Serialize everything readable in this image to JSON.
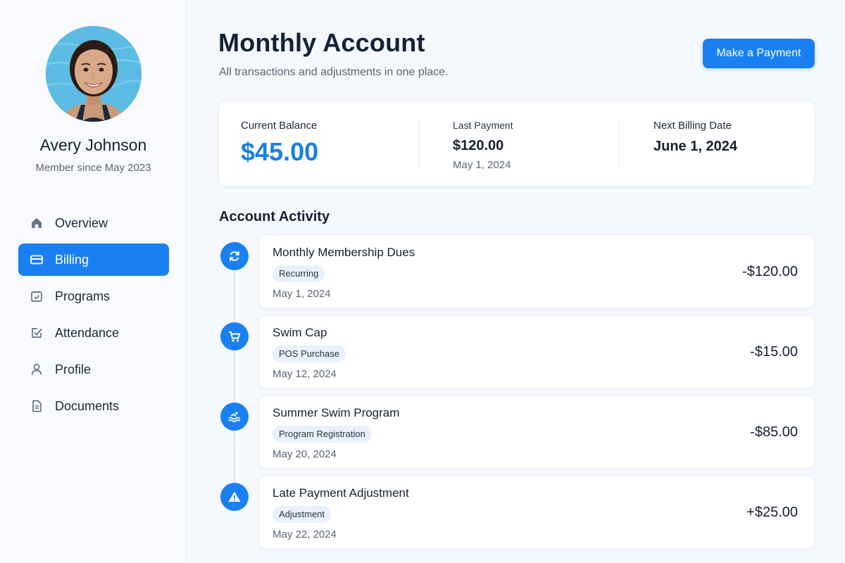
{
  "sidebar": {
    "user_name": "Avery Johnson",
    "member_since": "Member since May 2023",
    "nav": [
      {
        "label": "Overview",
        "icon": "home-icon",
        "active": false
      },
      {
        "label": "Billing",
        "icon": "card-icon",
        "active": true
      },
      {
        "label": "Programs",
        "icon": "calendar-check-icon",
        "active": false
      },
      {
        "label": "Attendance",
        "icon": "checkmark-square-icon",
        "active": false
      },
      {
        "label": "Profile",
        "icon": "person-icon",
        "active": false
      },
      {
        "label": "Documents",
        "icon": "document-icon",
        "active": false
      }
    ]
  },
  "header": {
    "title": "Monthly Account",
    "subtitle": "All transactions and adjustments in one place.",
    "pay_button": "Make a Payment"
  },
  "summary": {
    "balance_label": "Current Balance",
    "balance_value": "$45.00",
    "last_payment_label": "Last Payment",
    "last_payment_value": "$120.00",
    "last_payment_date": "May 1, 2024",
    "next_billing_label": "Next Billing Date",
    "next_billing_value": "June 1, 2024"
  },
  "activity": {
    "title": "Account Activity",
    "items": [
      {
        "title": "Monthly Membership Dues",
        "tag": "Recurring",
        "date": "May 1, 2024",
        "amount": "-$120.00",
        "icon": "refresh-icon"
      },
      {
        "title": "Swim Cap",
        "tag": "POS Purchase",
        "date": "May 12, 2024",
        "amount": "-$15.00",
        "icon": "cart-icon"
      },
      {
        "title": "Summer Swim Program",
        "tag": "Program Registration",
        "date": "May 20, 2024",
        "amount": "-$85.00",
        "icon": "swim-icon"
      },
      {
        "title": "Late Payment Adjustment",
        "tag": "Adjustment",
        "date": "May 22, 2024",
        "amount": "+$25.00",
        "icon": "warning-icon"
      }
    ]
  },
  "colors": {
    "accent": "#1a80f2",
    "balance": "#1a7fe8",
    "tag_bg": "#e8f1fc",
    "background": "#f5f8fc"
  }
}
